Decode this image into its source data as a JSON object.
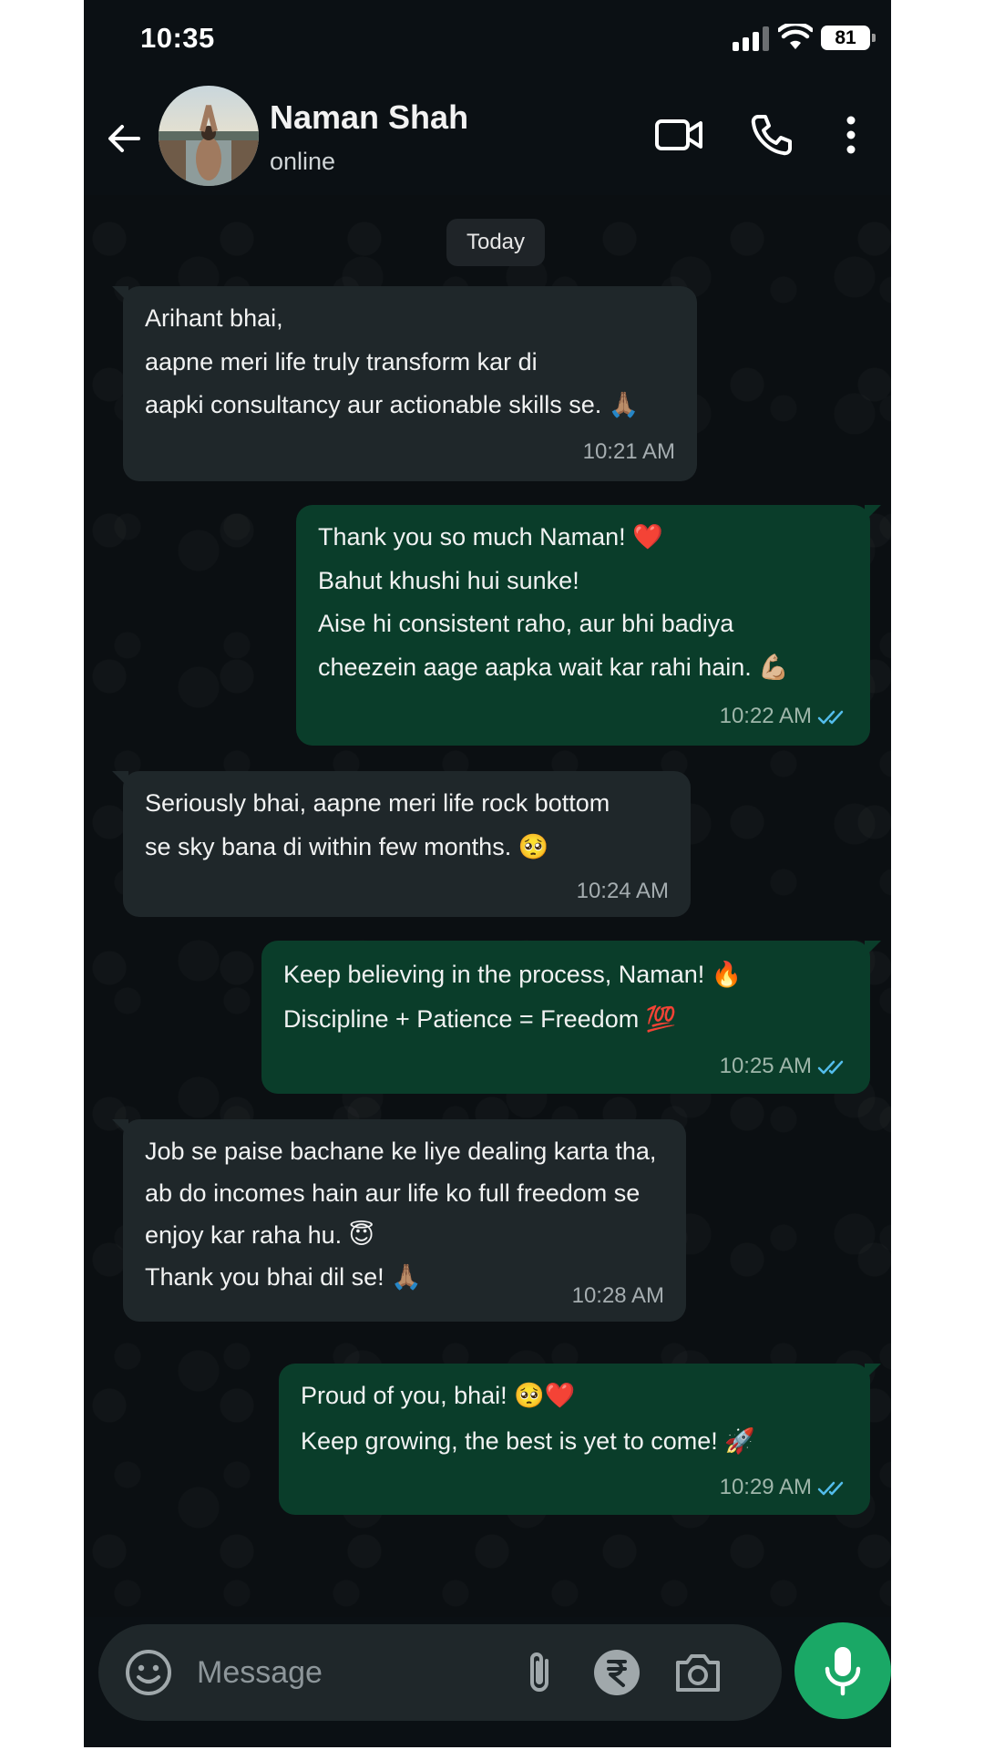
{
  "status_bar": {
    "time": "10:35",
    "battery": "81"
  },
  "header": {
    "name": "Naman Shah",
    "status": "online"
  },
  "date_chip": "Today",
  "messages": [
    {
      "direction": "incoming",
      "lines": [
        "Arihant bhai,",
        "aapne meri life truly transform kar di",
        "aapki consultancy aur actionable skills se. 🙏🏽"
      ],
      "time": "10:21 AM"
    },
    {
      "direction": "outgoing",
      "lines": [
        "Thank you so much Naman! ❤️",
        "Bahut khushi hui sunke!",
        "Aise hi consistent raho, aur bhi badiya",
        "cheezein aage aapka wait kar rahi hain. 💪🏼"
      ],
      "time": "10:22 AM",
      "read": true
    },
    {
      "direction": "incoming",
      "lines": [
        "Seriously bhai, aapne meri life rock bottom",
        "se sky bana di within few months. 🥺"
      ],
      "time": "10:24 AM"
    },
    {
      "direction": "outgoing",
      "lines": [
        "Keep believing in the process, Naman! 🔥",
        "Discipline + Patience = Freedom 💯"
      ],
      "time": "10:25 AM",
      "read": true
    },
    {
      "direction": "incoming",
      "lines": [
        "Job se paise bachane ke liye dealing karta tha,",
        "ab do incomes hain aur life ko full freedom se",
        "enjoy kar raha hu. 😇",
        "Thank you bhai dil se! 🙏🏽"
      ],
      "time": "10:28 AM"
    },
    {
      "direction": "outgoing",
      "lines": [
        "Proud of you, bhai! 🥺❤️",
        "Keep growing, the best is yet to come! 🚀"
      ],
      "time": "10:29 AM",
      "read": true
    }
  ],
  "composer": {
    "placeholder": "Message"
  },
  "colors": {
    "incoming_bubble": "#1f272a",
    "outgoing_bubble": "#0a3d2a",
    "mic_button": "#1aa866",
    "read_ticks": "#53bdeb"
  },
  "icons": [
    "back-arrow-icon",
    "video-call-icon",
    "phone-icon",
    "more-options-icon",
    "emoji-icon",
    "attachment-icon",
    "rupee-payment-icon",
    "camera-icon",
    "microphone-icon"
  ]
}
